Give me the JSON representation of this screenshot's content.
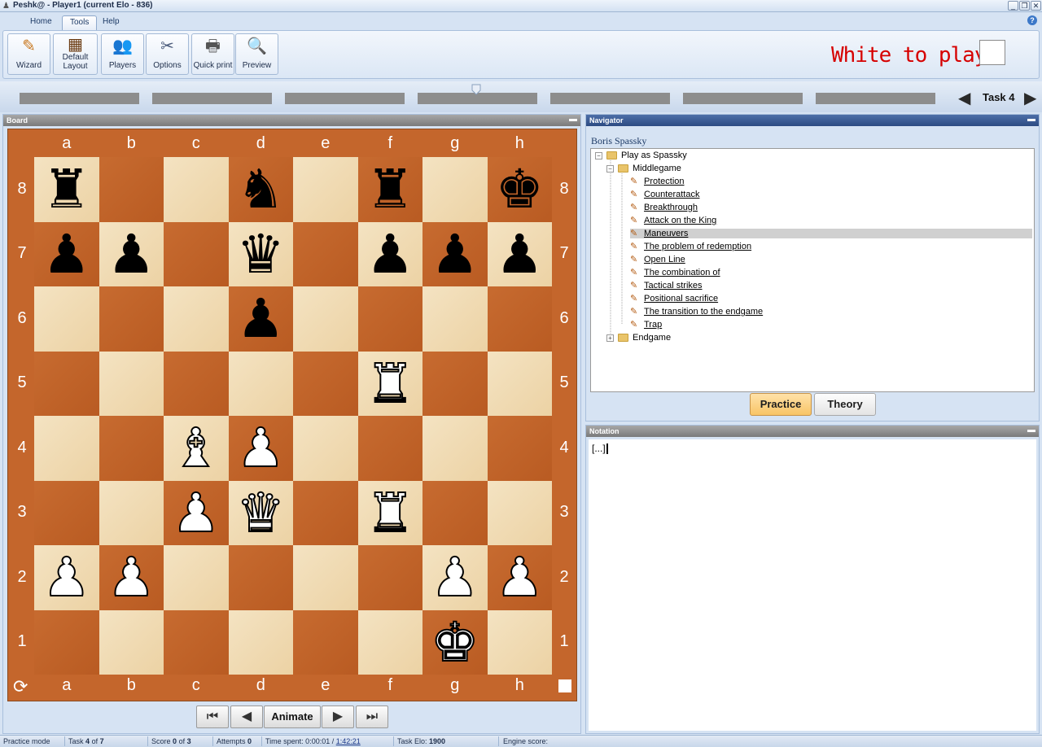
{
  "window": {
    "title": "Peshk@ - Player1 (current Elo - 836)"
  },
  "tabs": [
    {
      "label": "Home"
    },
    {
      "label": "Tools"
    },
    {
      "label": "Help"
    }
  ],
  "ribbon": {
    "wizard": "Wizard",
    "default_layout_line1": "Default",
    "default_layout_line2": "Layout",
    "players": "Players",
    "options": "Options",
    "quick_print": "Quick print",
    "preview": "Preview"
  },
  "to_play": "White to play",
  "task_label": "Task 4",
  "panels": {
    "board": "Board",
    "navigator": "Navigator",
    "notation": "Notation"
  },
  "board": {
    "files": [
      "a",
      "b",
      "c",
      "d",
      "e",
      "f",
      "g",
      "h"
    ],
    "ranks": [
      "8",
      "7",
      "6",
      "5",
      "4",
      "3",
      "2",
      "1"
    ],
    "position": [
      [
        "r",
        "",
        "",
        "n",
        "",
        "r",
        "",
        "k"
      ],
      [
        "p",
        "p",
        "",
        "q",
        "",
        "p",
        "p",
        "p"
      ],
      [
        "",
        "",
        "",
        "p",
        "",
        "",
        "",
        ""
      ],
      [
        "",
        "",
        "",
        "",
        "",
        "R",
        "",
        ""
      ],
      [
        "",
        "",
        "B",
        "P",
        "",
        "",
        "",
        ""
      ],
      [
        "",
        "",
        "P",
        "Q",
        "",
        "R",
        "",
        ""
      ],
      [
        "P",
        "P",
        "",
        "",
        "",
        "",
        "P",
        "P"
      ],
      [
        "",
        "",
        "",
        "",
        "",
        "",
        "K",
        ""
      ]
    ]
  },
  "board_buttons": {
    "first": "⏮",
    "prev": "◀",
    "animate": "Animate",
    "next": "▶",
    "last": "⏭"
  },
  "navigator": {
    "player_name": "Boris Spassky",
    "root": "Play as Spassky",
    "middlegame": "Middlegame",
    "tasks": [
      "Protection",
      "Counterattack",
      "Breakthrough",
      "Attack on the King",
      "Maneuvers",
      "The problem of redemption",
      "Open Line",
      "The combination of",
      "Tactical strikes",
      "Positional sacrifice",
      "The transition to the endgame",
      "Trap"
    ],
    "endgame": "Endgame",
    "selected_task": "Maneuvers"
  },
  "buttons": {
    "practice": "Practice",
    "theory": "Theory"
  },
  "notation": {
    "text": "[...]"
  },
  "status": {
    "mode": "Practice mode",
    "task_prefix": "Task",
    "task_num": "4",
    "task_of": "of",
    "task_total": "7",
    "score_prefix": "Score",
    "score_val": "0",
    "score_of": "of",
    "score_total": "3",
    "attempts_prefix": "Attempts",
    "attempts_val": "0",
    "time_prefix": "Time spent: 0:00:01 /",
    "time_total": "1:42:21",
    "elo_prefix": "Task Elo:",
    "elo_val": "1900",
    "engine": "Engine score:"
  },
  "colors": {
    "to_play": "#d60000",
    "dark_square": "#c0622a",
    "light_square": "#f0d9b0",
    "board_frame": "#c4662c"
  }
}
